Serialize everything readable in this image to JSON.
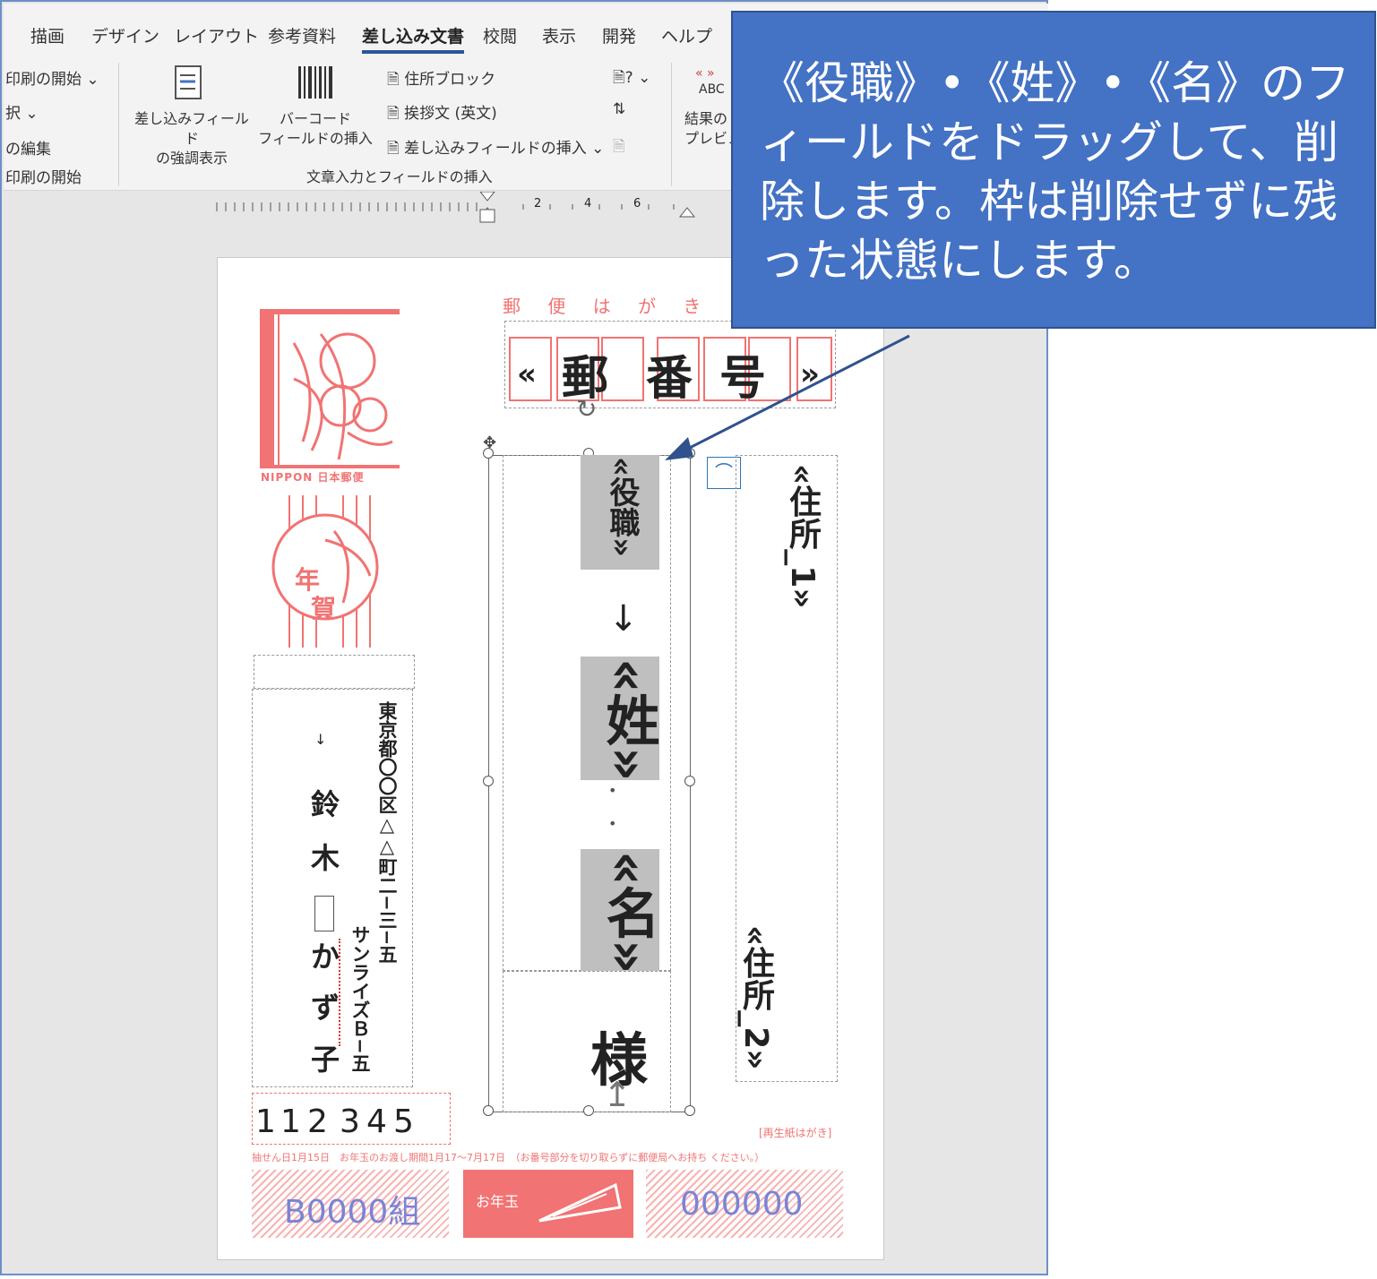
{
  "ribbon": {
    "tabs": [
      "描画",
      "デザイン",
      "レイアウト",
      "参考資料",
      "差し込み文書",
      "校閲",
      "表示",
      "開発",
      "ヘルプ"
    ],
    "left_items": [
      "印刷の開始",
      "択",
      "の編集",
      "印刷の開始"
    ],
    "highlight_fields": "差し込みフィールド\nの強調表示",
    "barcode": "バーコード\nフィールドの挿入",
    "address_block": "住所ブロック",
    "greeting_en": "挨拶文 (英文)",
    "insert_merge_field": "差し込みフィールドの挿入",
    "group_label": "文章入力とフィールドの挿入",
    "abc_label": "ABC",
    "preview": "結果の\nプレビュー"
  },
  "ruler": {
    "marks": [
      "2",
      "4",
      "6"
    ]
  },
  "postcard": {
    "header": "郵 便 は が き",
    "postal_field": [
      "«",
      "郵",
      "番",
      "号",
      "»"
    ],
    "name_fields": {
      "title": "«役職»",
      "arrow": "↓",
      "last": "«姓»",
      "dot1": "•",
      "dot2": "•",
      "first": "«名»"
    },
    "honorific": "様",
    "address1": "«住所_1»",
    "address2": "«住所_2»",
    "sender_arrow": "↓",
    "sender_name": [
      "鈴",
      "木",
      "",
      "か",
      "ず",
      "子"
    ],
    "sender_address": "東京都〇〇区△△町二−三−五",
    "sender_building": "サンライズＢ−五",
    "sender_zip": [
      "1",
      "1",
      "2",
      "3",
      "4",
      "5"
    ],
    "stamp_text": "NIPPON 日本郵便",
    "nenga": [
      "年",
      "賀"
    ],
    "recycled": "[再生紙はがき]",
    "lottery_notice": "抽せん日1月15日　お年玉のお渡し期間1月17〜7月17日　（お番号部分を切り取らずに郵便局へお持ち ください。）",
    "lottery_group": "B0000組",
    "lottery_label": "お年玉",
    "lottery_number": "000000"
  },
  "callout": {
    "text": "《役職》•《姓》•《名》のフィールドをドラッグして、削除します。枠は削除せずに残った状態にします。"
  },
  "colors": {
    "accent": "#4472c4",
    "stamp_red": "#f17373",
    "field_gray": "#bfbfbf"
  }
}
